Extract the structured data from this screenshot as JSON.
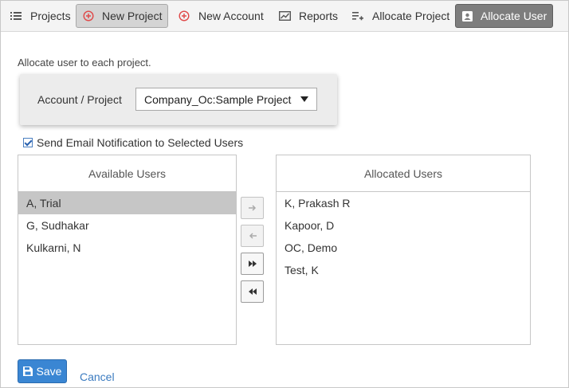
{
  "toolbar": {
    "items": [
      {
        "label": "Projects",
        "icon": "list-icon"
      },
      {
        "label": "New Project",
        "icon": "add-circle-icon",
        "state": "active"
      },
      {
        "label": "New Account",
        "icon": "add-circle-icon"
      },
      {
        "label": "Reports",
        "icon": "chart-icon"
      },
      {
        "label": "Allocate Project",
        "icon": "playlist-add-icon"
      },
      {
        "label": "Allocate User",
        "icon": "user-badge-icon",
        "state": "selected-dark"
      }
    ]
  },
  "instruction": "Allocate user to each project.",
  "selector": {
    "label": "Account / Project",
    "value": "Company_Oc:Sample Project"
  },
  "notification": {
    "label": "Send Email Notification to Selected Users",
    "checked": true
  },
  "available": {
    "header": "Available Users",
    "users": [
      "A, Trial",
      "G, Sudhakar",
      "Kulkarni, N"
    ],
    "selected_index": 0
  },
  "allocated": {
    "header": "Allocated Users",
    "users": [
      "K, Prakash R",
      "Kapoor, D",
      "OC, Demo",
      "Test, K"
    ]
  },
  "move_buttons": [
    {
      "icon": "arrow-right-icon",
      "enabled": false
    },
    {
      "icon": "arrow-left-icon",
      "enabled": false
    },
    {
      "icon": "double-chevron-right-icon",
      "enabled": true
    },
    {
      "icon": "double-chevron-left-icon",
      "enabled": true
    }
  ],
  "actions": {
    "save_label": "Save",
    "cancel_label": "Cancel"
  },
  "colors": {
    "accent": "#3a86d3",
    "link": "#3b7bc0",
    "add_icon": "#e04848",
    "dark_tab": "#7d7d7d",
    "selected_row": "#c6c6c6"
  }
}
